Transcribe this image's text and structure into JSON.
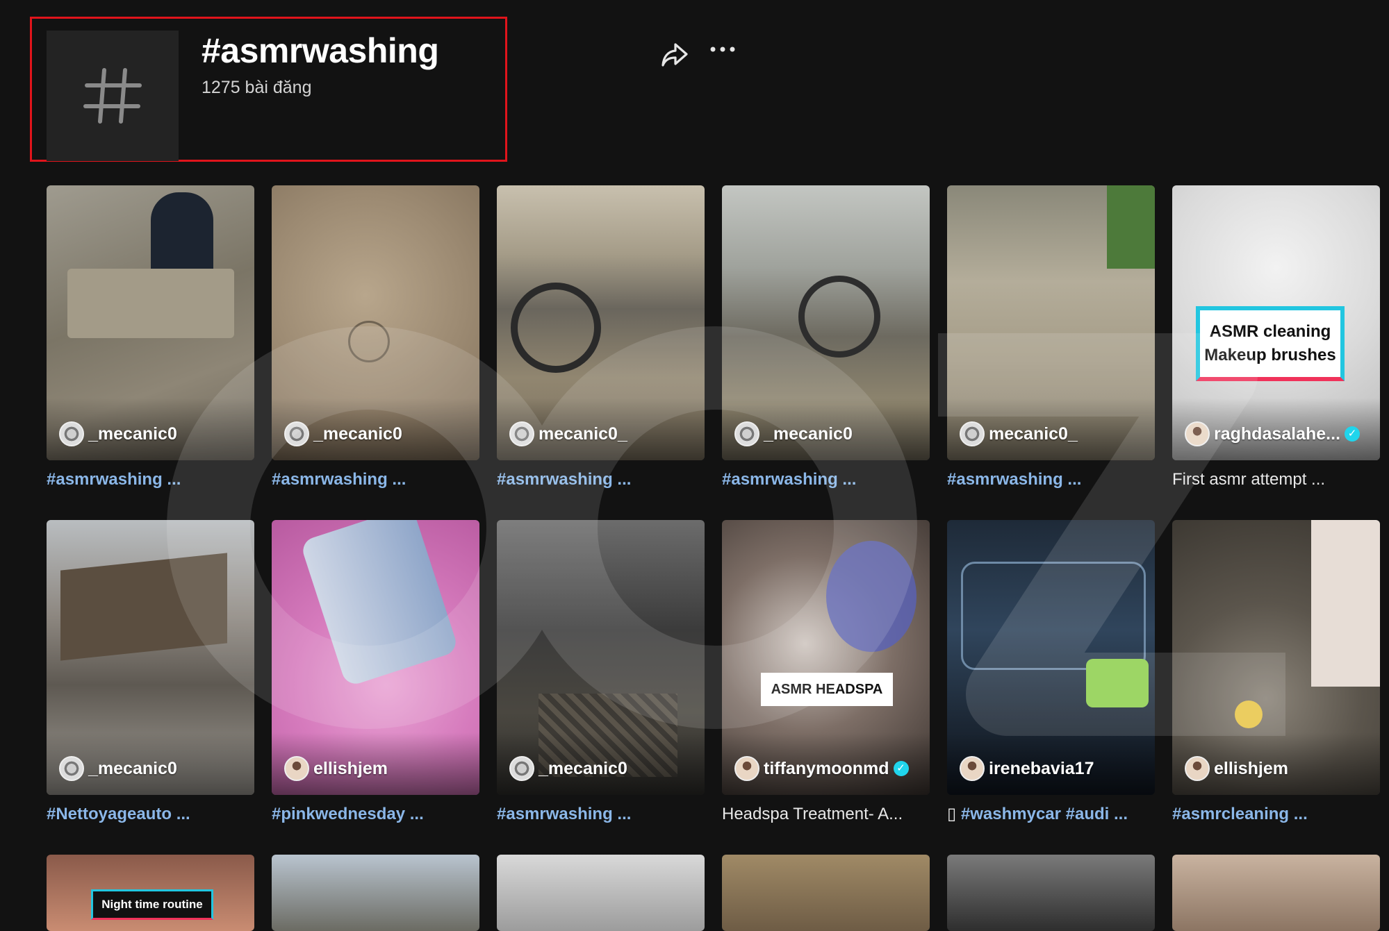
{
  "header": {
    "title": "#asmrwashing",
    "post_count": "1275 bài đăng",
    "hash_glyph": "#"
  },
  "icons": {
    "share": "share-icon",
    "more": "more-options-icon"
  },
  "highlight_color": "#e0141b",
  "videos": [
    {
      "author": "_mecanic0",
      "caption_tag": "#asmrwashing ...",
      "caption_text": "",
      "verified": false
    },
    {
      "author": "_mecanic0",
      "caption_tag": "#asmrwashing ...",
      "caption_text": "",
      "verified": false
    },
    {
      "author": "mecanic0_",
      "caption_tag": "#asmrwashing ...",
      "caption_text": "",
      "verified": false
    },
    {
      "author": "_mecanic0",
      "caption_tag": "#asmrwashing ...",
      "caption_text": "",
      "verified": false
    },
    {
      "author": "mecanic0_",
      "caption_tag": "#asmrwashing ...",
      "caption_text": "",
      "verified": false
    },
    {
      "author": "raghdasalahe...",
      "caption_tag": "",
      "caption_text": "First asmr attempt ...",
      "verified": true,
      "overlay": "ASMR cleaning Makeup brushes"
    },
    {
      "author": "_mecanic0",
      "caption_tag": "#Nettoyageauto ...",
      "caption_text": "",
      "verified": false
    },
    {
      "author": "ellishjem",
      "caption_tag": "#pinkwednesday ...",
      "caption_text": "",
      "verified": false
    },
    {
      "author": "_mecanic0",
      "caption_tag": "#asmrwashing ...",
      "caption_text": "",
      "verified": false
    },
    {
      "author": "tiffanymoonmd",
      "caption_tag": "",
      "caption_text": "Headspa Treatment- A...",
      "verified": true,
      "overlay": "ASMR HEADSPA"
    },
    {
      "author": "irenebavia17",
      "caption_tag": "#washmycar #audi ...",
      "caption_text": "",
      "caption_prefix": "▯",
      "verified": false
    },
    {
      "author": "ellishjem",
      "caption_tag": "#asmrcleaning ...",
      "caption_text": "",
      "verified": false
    }
  ],
  "third_row_overlay": "Night time routine"
}
